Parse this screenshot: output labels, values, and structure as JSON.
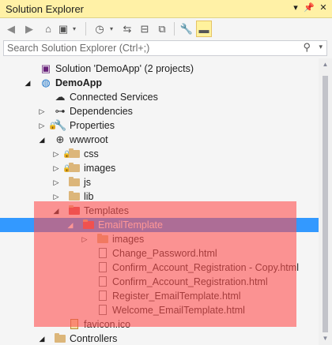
{
  "window": {
    "title": "Solution Explorer"
  },
  "title_buttons": [
    "▾",
    "📌",
    "✕"
  ],
  "search": {
    "placeholder": "Search Solution Explorer (Ctrl+;)"
  },
  "tree": [
    {
      "label": "Solution 'DemoApp' (2 projects)",
      "icon": "solution-icon",
      "twisty": "",
      "lock": false,
      "bold": false,
      "selected": false
    },
    {
      "label": "DemoApp",
      "icon": "web-project-icon",
      "twisty": "◢",
      "lock": false,
      "bold": true,
      "selected": false
    },
    {
      "label": "Connected Services",
      "icon": "cloud-icon",
      "twisty": "",
      "lock": false,
      "bold": false,
      "selected": false
    },
    {
      "label": "Dependencies",
      "icon": "dependencies-icon",
      "twisty": "▷",
      "lock": false,
      "bold": false,
      "selected": false
    },
    {
      "label": "Properties",
      "icon": "wrench-icon",
      "twisty": "▷",
      "lock": true,
      "bold": false,
      "selected": false
    },
    {
      "label": "wwwroot",
      "icon": "globe-icon",
      "twisty": "◢",
      "lock": false,
      "bold": false,
      "selected": false
    },
    {
      "label": "css",
      "icon": "folder-icon",
      "twisty": "▷",
      "lock": true,
      "bold": false,
      "selected": false
    },
    {
      "label": "images",
      "icon": "folder-icon",
      "twisty": "▷",
      "lock": true,
      "bold": false,
      "selected": false
    },
    {
      "label": "js",
      "icon": "folder-icon",
      "twisty": "▷",
      "lock": false,
      "bold": false,
      "selected": false
    },
    {
      "label": "lib",
      "icon": "folder-icon",
      "twisty": "▷",
      "lock": false,
      "bold": false,
      "selected": false
    },
    {
      "label": "Templates",
      "icon": "folder-icon",
      "twisty": "◢",
      "lock": false,
      "bold": false,
      "selected": false
    },
    {
      "label": "EmailTemplate",
      "icon": "folder-icon",
      "twisty": "◢",
      "lock": false,
      "bold": false,
      "selected": true
    },
    {
      "label": "images",
      "icon": "folder-icon",
      "twisty": "▷",
      "lock": false,
      "bold": false,
      "selected": false
    },
    {
      "label": "Change_Password.html",
      "icon": "html-file-icon",
      "twisty": "",
      "lock": false,
      "bold": false,
      "selected": false
    },
    {
      "label": "Confirm_Account_Registration - Copy.html",
      "icon": "html-file-icon",
      "twisty": "",
      "lock": false,
      "bold": false,
      "selected": false
    },
    {
      "label": "Confirm_Account_Registration.html",
      "icon": "html-file-icon",
      "twisty": "",
      "lock": false,
      "bold": false,
      "selected": false
    },
    {
      "label": "Register_EmailTemplate.html",
      "icon": "html-file-icon",
      "twisty": "",
      "lock": false,
      "bold": false,
      "selected": false
    },
    {
      "label": "Welcome_EmailTemplate.html",
      "icon": "html-file-icon",
      "twisty": "",
      "lock": false,
      "bold": false,
      "selected": false
    },
    {
      "label": "favicon.ico",
      "icon": "ico-file-icon",
      "twisty": "",
      "lock": false,
      "bold": false,
      "selected": false
    },
    {
      "label": "Controllers",
      "icon": "folder-icon",
      "twisty": "◢",
      "lock": false,
      "bold": false,
      "selected": false
    }
  ],
  "colors": {
    "selection": "#3399ff",
    "highlight_overlay": "#ff5050",
    "title_bar": "#fff1a6",
    "folder": "#dcb67a"
  }
}
